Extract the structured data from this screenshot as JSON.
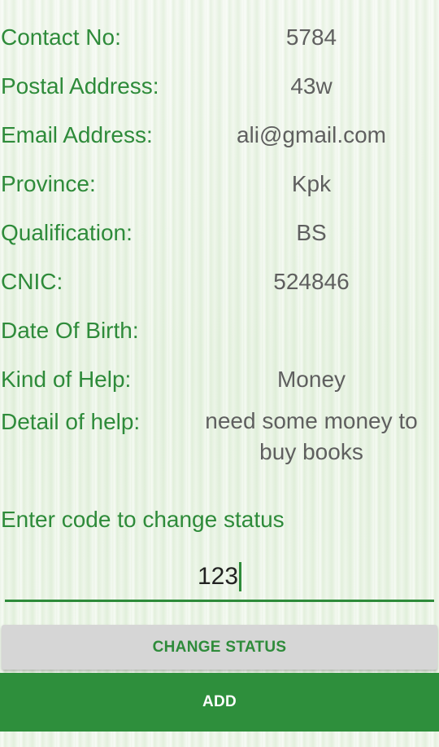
{
  "fields": [
    {
      "label": "Contact No:",
      "value": "5784"
    },
    {
      "label": "Postal Address:",
      "value": "43w"
    },
    {
      "label": "Email Address:",
      "value": "ali@gmail.com"
    },
    {
      "label": "Province:",
      "value": "Kpk"
    },
    {
      "label": "Qualification:",
      "value": "BS"
    },
    {
      "label": "CNIC:",
      "value": "524846"
    },
    {
      "label": "Date Of Birth:",
      "value": ""
    },
    {
      "label": "Kind of Help:",
      "value": "Money"
    },
    {
      "label": "Detail of help:",
      "value": "need some money to buy books"
    }
  ],
  "status": {
    "prompt": "Enter code to change status",
    "code_value": "123"
  },
  "buttons": {
    "change_status": "CHANGE STATUS",
    "add": "ADD"
  },
  "colors": {
    "accent_green": "#2e8b3a",
    "button_green": "#2e8f3c",
    "value_gray": "#5f5f5f"
  }
}
